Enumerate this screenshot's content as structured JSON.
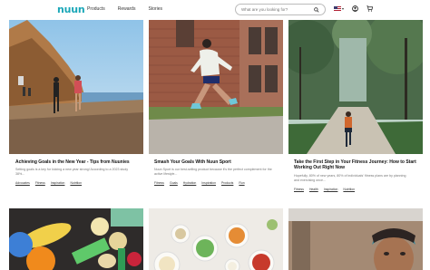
{
  "header": {
    "logo": "nuun",
    "nav": [
      "Products",
      "Rewards",
      "Stories"
    ],
    "search_placeholder": "What are you looking for?",
    "icons": [
      "search-icon",
      "flag-icon",
      "account-icon",
      "cart-icon"
    ]
  },
  "cards": [
    {
      "title": "Achieving Goals in the New Year - Tips from Nuunies",
      "excerpt_line1": "Setting goals is a key for kicking a new year strong! According to a 2023 study",
      "excerpt_line2": "38%...",
      "tags": [
        "Advocates",
        "Fitness",
        "Inspiration",
        "Nutrition"
      ]
    },
    {
      "title": "Smash Your Goals With Nuun Sport",
      "excerpt_line1": "Nuun Sport is our best-selling product because it's the perfect complement for the",
      "excerpt_line2": "active lifestyle...",
      "tags": [
        "Fitness",
        "Goals",
        "Hydration",
        "Inspiration",
        "Products",
        "Run"
      ]
    },
    {
      "title": "Take the First Step in Your Fitness Journey: How to Start Working Out Right Now",
      "excerpt_line1": "Hopefully, 80% of new years, 80% of individuals' fitness plans are by planning",
      "excerpt_line2": "and exercising once...",
      "tags": [
        "Fitness",
        "Health",
        "Inspiration",
        "Nutrition"
      ]
    }
  ],
  "colors": {
    "brand": "#1aa7b8"
  }
}
